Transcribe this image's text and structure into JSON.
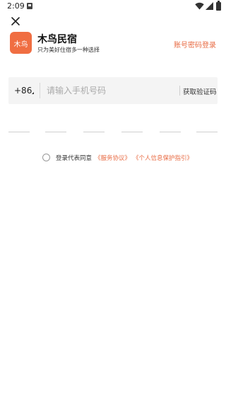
{
  "status_bar": {
    "time": "2:09",
    "icons": [
      "notification-icon",
      "wifi-icon",
      "signal-icon",
      "battery-icon"
    ]
  },
  "header": {
    "close_icon": "close-icon",
    "account_login": "账号密码登录"
  },
  "brand": {
    "logo_text": "木鸟",
    "name": "木鸟民宿",
    "slogan": "只为美好住宿多一种选择",
    "accent_color": "#f06e42"
  },
  "phone_form": {
    "country_code": "+86",
    "phone_placeholder": "请输入手机号码",
    "get_code_label": "获取验证码",
    "code_slot_count": 6
  },
  "agreement": {
    "prefix": "登录代表同意",
    "service_link": "《服务协议》",
    "privacy_link": "《个人信息保护指引》",
    "link_color": "#e86b43"
  }
}
